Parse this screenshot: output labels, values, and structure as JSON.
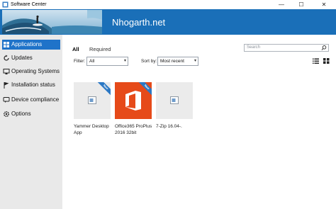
{
  "window": {
    "title": "Software Center",
    "minimize_glyph": "—",
    "maximize_glyph": "☐",
    "close_glyph": "✕"
  },
  "banner": {
    "org_name": "Nhogarth.net"
  },
  "sidebar": {
    "items": [
      {
        "label": "Applications",
        "icon": "grid-icon",
        "active": true
      },
      {
        "label": "Updates",
        "icon": "refresh-icon"
      },
      {
        "label": "Operating Systems",
        "icon": "monitor-icon"
      },
      {
        "label": "Installation status",
        "icon": "flag-icon"
      },
      {
        "label": "Device compliance",
        "icon": "chat-icon"
      },
      {
        "label": "Options",
        "icon": "gear-icon"
      }
    ]
  },
  "tabs": [
    {
      "label": "All",
      "active": true
    },
    {
      "label": "Required",
      "active": false
    }
  ],
  "search": {
    "placeholder": "Search"
  },
  "filter": {
    "label": "Filter:",
    "value": "All"
  },
  "sort": {
    "label": "Sort by:",
    "value": "Most recent"
  },
  "apps": [
    {
      "name": "Yammer Desktop App",
      "badge": "New",
      "icon": "placeholder-app-icon"
    },
    {
      "name": "Office365 ProPlus 2016 32bit",
      "badge": "New",
      "icon": "office-icon"
    },
    {
      "name": "7-Zip 16.04-.",
      "badge": "",
      "icon": "placeholder-app-icon"
    }
  ],
  "colors": {
    "accent": "#1f73c9",
    "banner": "#1a6fb8",
    "office_tile": "#e64a19",
    "sidebar_bg": "#e9e9e9"
  }
}
